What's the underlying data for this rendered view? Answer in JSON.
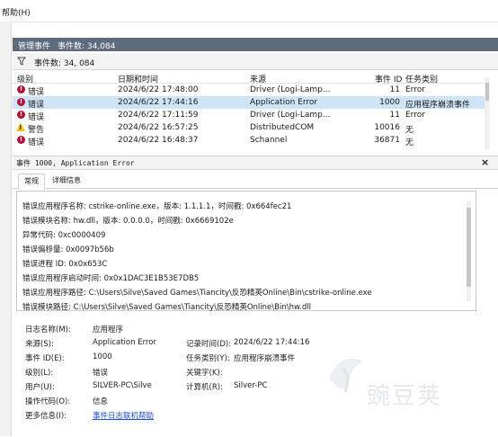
{
  "menubar": {
    "help": "帮助(H)"
  },
  "header": {
    "title": "管理事件",
    "count": "事件数: 34,084"
  },
  "filter": {
    "label": "事件数: 34, 084"
  },
  "table": {
    "columns": [
      "级别",
      "日期和时间",
      "来源",
      "事件 ID",
      "任务类别"
    ],
    "rows": [
      {
        "level": "错误",
        "datetime": "2024/6/22 17:48:00",
        "source": "Driver (Logi-Lamp...",
        "id": "11",
        "category": "Error",
        "type": "error",
        "selected": false
      },
      {
        "level": "错误",
        "datetime": "2024/6/22 17:44:16",
        "source": "Application Error",
        "id": "1000",
        "category": "应用程序崩溃事件",
        "type": "error",
        "selected": true
      },
      {
        "level": "错误",
        "datetime": "2024/6/22 17:11:59",
        "source": "Driver (Logi-Lamp...",
        "id": "11",
        "category": "Error",
        "type": "error",
        "selected": false
      },
      {
        "level": "警告",
        "datetime": "2024/6/22 16:57:25",
        "source": "DistributedCOM",
        "id": "10016",
        "category": "无",
        "type": "warning",
        "selected": false
      },
      {
        "level": "错误",
        "datetime": "2024/6/22 16:48:37",
        "source": "Schannel",
        "id": "36871",
        "category": "无",
        "type": "error",
        "selected": false
      }
    ]
  },
  "detail": {
    "title": "事件 1000, Application Error",
    "close": "×",
    "tabs": [
      "常规",
      "详细信息"
    ],
    "message": [
      "错误应用程序名称: cstrike-online.exe，版本: 1.1.1.1，时间戳: 0x664fec21",
      "错误模块名称: hw.dll，版本: 0.0.0.0，时间戳: 0x6669102e",
      "异常代码: 0xc0000409",
      "错误偏移量: 0x0097b56b",
      "错误进程 ID: 0x0x653C",
      "错误应用程序启动时间: 0x0x1DAC3E1B53E7DB5",
      "错误应用程序路径: C:\\Users\\Silve\\Saved Games\\Tiancity\\反恐精英Online\\Bin\\cstrike-online.exe",
      "错误模块路径: C:\\Users\\Silve\\Saved Games\\Tiancity\\反恐精英Online\\Bin\\hw.dll"
    ],
    "fields": {
      "log_name_label": "日志名称(M):",
      "log_name": "应用程序",
      "source_label": "来源(S):",
      "source": "Application Error",
      "logged_label": "记录时间(D):",
      "logged": "2024/6/22 17:44:16",
      "event_id_label": "事件 ID(E):",
      "event_id": "1000",
      "task_label": "任务类别(Y):",
      "task": "应用程序崩溃事件",
      "level_label": "级别(L):",
      "level": "错误",
      "keywords_label": "关键字(K):",
      "keywords": "",
      "user_label": "用户(U):",
      "user": "SILVER-PC\\Silve",
      "computer_label": "计算机(R):",
      "computer": "Silver-PC",
      "opcode_label": "操作代码(O):",
      "opcode": "信息",
      "more_label": "更多信息(I):",
      "more_link": "事件日志联机帮助"
    }
  },
  "watermark": "豌豆荚",
  "colors": {
    "header_bg": "#5d6b7d",
    "selection": "#cfe4f7",
    "error": "#b3123b",
    "warning": "#f0c419",
    "link": "#1a4fd6"
  }
}
